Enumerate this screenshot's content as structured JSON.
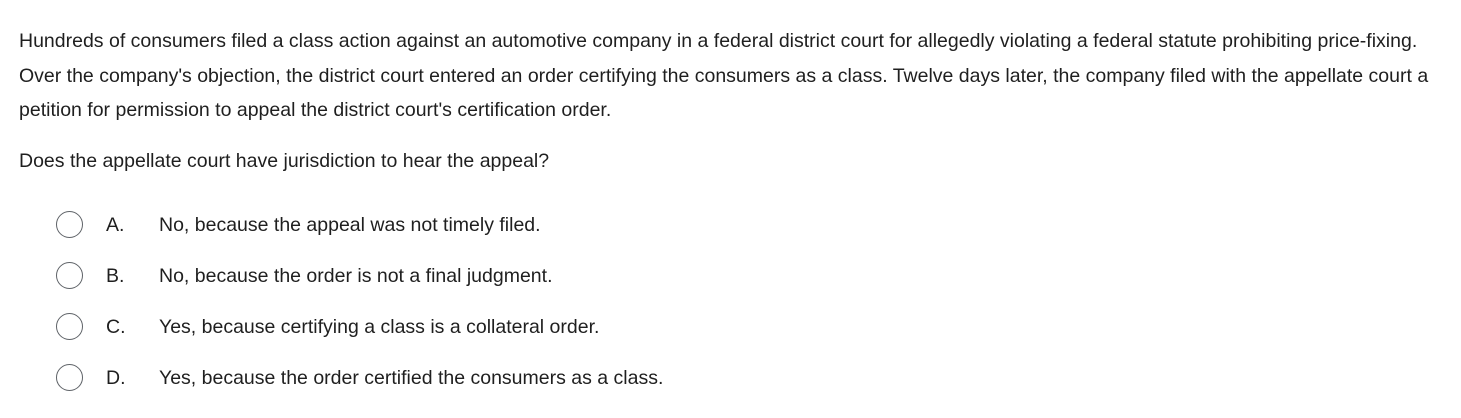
{
  "question": {
    "stem": "Hundreds of consumers filed a class action against an automotive company in a federal district court for allegedly violating a federal statute prohibiting price-fixing.  Over the company's objection, the district court entered an order certifying the consumers as a class.  Twelve days later, the company filed with the appellate court a petition for permission to appeal the district court's certification order.",
    "prompt": "Does the appellate court have jurisdiction to hear the appeal?"
  },
  "options": [
    {
      "letter": "A.",
      "text": "No, because the appeal was not timely filed."
    },
    {
      "letter": "B.",
      "text": "No, because the order is not a final judgment."
    },
    {
      "letter": "C.",
      "text": "Yes, because certifying a class is a collateral order."
    },
    {
      "letter": "D.",
      "text": "Yes, because the order certified the consumers as a class."
    }
  ]
}
